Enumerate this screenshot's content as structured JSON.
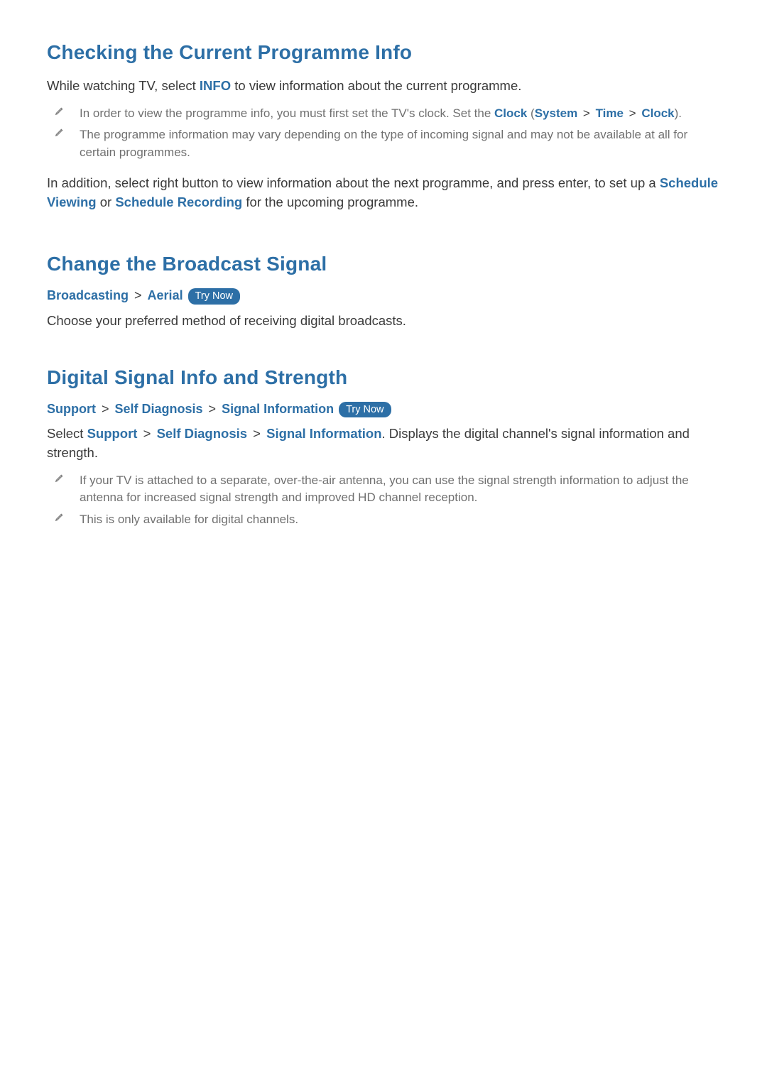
{
  "section1": {
    "title": "Checking the Current Programme Info",
    "intro_prefix": "While watching TV, select ",
    "intro_info": "INFO",
    "intro_suffix": " to view information about the current programme.",
    "note1_prefix": "In order to view the programme info, you must first set the TV's clock. Set the ",
    "note1_clock": "Clock",
    "note1_open": " (",
    "note1_system": "System",
    "note1_sep1": " > ",
    "note1_time": "Time",
    "note1_sep2": " > ",
    "note1_clock2": "Clock",
    "note1_close": ").",
    "note2": "The programme information may vary depending on the type of incoming signal and may not be available at all for certain programmes.",
    "outro_prefix": "In addition, select right button to view information about the next programme, and press enter, to set up a ",
    "outro_link1": "Schedule Viewing",
    "outro_mid": " or ",
    "outro_link2": "Schedule Recording",
    "outro_suffix": " for the upcoming programme."
  },
  "section2": {
    "title": "Change the Broadcast Signal",
    "bc_broadcasting": "Broadcasting",
    "bc_sep": " > ",
    "bc_aerial": "Aerial",
    "try_now": "Try Now",
    "body": "Choose your preferred method of receiving digital broadcasts."
  },
  "section3": {
    "title": "Digital Signal Info and Strength",
    "bc_support": "Support",
    "bc_sep1": " > ",
    "bc_self": "Self Diagnosis",
    "bc_sep2": " > ",
    "bc_signal": "Signal Information",
    "try_now": "Try Now",
    "body_prefix": "Select ",
    "body_support": "Support",
    "body_sep1": " > ",
    "body_self": "Self Diagnosis",
    "body_sep2": " > ",
    "body_signal": "Signal Information",
    "body_suffix": ". Displays the digital channel's signal information and strength.",
    "note1": "If your TV is attached to a separate, over-the-air antenna, you can use the signal strength information to adjust the antenna for increased signal strength and improved HD channel reception.",
    "note2": "This is only available for digital channels."
  }
}
